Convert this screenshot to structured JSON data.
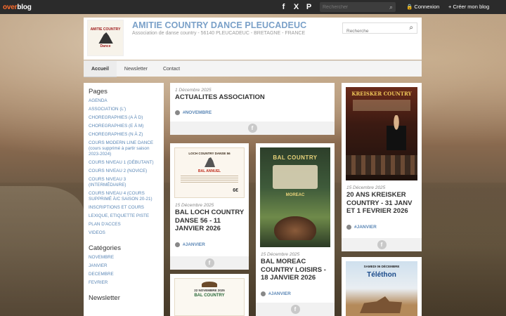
{
  "topbar": {
    "logo_over": "over",
    "logo_blog": "blog",
    "search_placeholder": "Rechercher",
    "login": "🔒 Connexion",
    "create": "+ Créer mon blog"
  },
  "header": {
    "logo_line1": "AMITIE COUNTRY",
    "logo_line2": "Dance",
    "title": "AMITIE COUNTRY DANCE PLEUCADEUC",
    "subtitle": "Association de danse country - 56140 PLEUCADEUC - BRETAGNE - FRANCE",
    "search_placeholder": "Recherche"
  },
  "nav": [
    "Accueil",
    "Newsletter",
    "Contact"
  ],
  "sidebar": {
    "pages_title": "Pages",
    "pages": [
      "AGENDA",
      "ASSOCIATION (L')",
      "CHOREGRAPHIES (A à D)",
      "CHOREGRAPHIES (E à M)",
      "CHOREGRAPHIES (N à Z)",
      "COURS MODERN LINE DANCE (cours supprimé à partir saison 2023-2024)",
      "COURS NIVEAU 1 (débutant)",
      "COURS NIVEAU 2 (novice)",
      "COURS NIVEAU 3 (intermédiaire)",
      "COURS NIVEAU 4 (cours supprimé à/c saison 20-21)",
      "INSCRIPTIONS et COURS",
      "LEXIQUE, ETIQUETTE PISTE",
      "PLAN D'ACCES",
      "VIDEOS"
    ],
    "categories_title": "Catégories",
    "categories": [
      "NOVEMBRE",
      "JANVIER",
      "DECEMBRE",
      "FEVRIER"
    ],
    "newsletter_title": "Newsletter"
  },
  "posts": {
    "p1": {
      "date": "1 Décembre 2025",
      "title": "ACTUALITES ASSOCIATION",
      "category": "#NOVEMBRE"
    },
    "p2": {
      "date": "15 Décembre 2025",
      "title": "BAL LOCH COUNTRY DANSE 56 - 11 JANVIER 2026",
      "category": "#JANVIER",
      "poster_title": "LOCH COUNTRY DANSE 56",
      "poster_sub": "BAL ANNUEL",
      "poster_price": "6€"
    },
    "p3": {
      "date": "15 Décembre 2025",
      "title": "BAL MOREAC COUNTRY LOISIRS - 18 JANVIER 2026",
      "category": "#JANVIER",
      "poster_title": "BAL COUNTRY",
      "poster_sub": "MOREAC"
    },
    "p4": {
      "date": "15 Décembre 2025",
      "title": "20 ANS KREISKER COUNTRY - 31 JANV ET 1 FEVRIER 2026",
      "category": "#JANVIER",
      "poster_title": "KREISKER COUNTRY"
    },
    "p5": {
      "poster_title": "BAL COUNTRY",
      "poster_date": "22 NOVEMBRE 2025"
    },
    "p6": {
      "poster_title": "Téléthon",
      "poster_date": "SAMEDI 06 DÉCEMBRE"
    }
  },
  "colors": {
    "accent": "#7aa0c8",
    "link": "#5b87b6",
    "brand": "#ff6c2c"
  },
  "icons": {
    "facebook": "f",
    "x": "X",
    "pinterest": "P",
    "search": "⌕"
  }
}
